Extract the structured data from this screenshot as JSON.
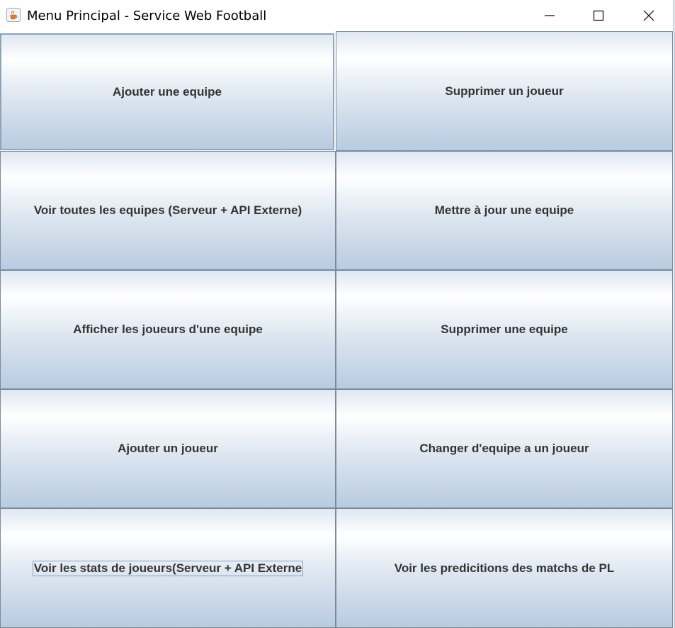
{
  "window": {
    "title": "Menu Principal - Service Web Football",
    "app_icon": "java-cup-icon",
    "controls": {
      "minimize_icon": "minimize-icon",
      "maximize_icon": "maximize-icon",
      "close_icon": "close-icon"
    }
  },
  "menu": {
    "buttons": [
      {
        "label": "Ajouter une equipe",
        "column": "left",
        "row": 1
      },
      {
        "label": "Supprimer un joueur",
        "column": "right",
        "row": 1
      },
      {
        "label": "Voir toutes les equipes (Serveur + API Externe)",
        "column": "left",
        "row": 2
      },
      {
        "label": "Mettre à jour une equipe",
        "column": "right",
        "row": 2
      },
      {
        "label": "Afficher les joueurs d'une equipe",
        "column": "left",
        "row": 3
      },
      {
        "label": "Supprimer une equipe",
        "column": "right",
        "row": 3
      },
      {
        "label": "Ajouter un joueur",
        "column": "left",
        "row": 4
      },
      {
        "label": "Changer d'equipe a un joueur",
        "column": "right",
        "row": 4
      },
      {
        "label": "Voir les stats de joueurs(Serveur + API Externe",
        "column": "left",
        "row": 5
      },
      {
        "label": "Voir les predicitions des matchs de PL",
        "column": "right",
        "row": 5
      }
    ]
  },
  "colors": {
    "button_border": "#7a8a9a",
    "button_top": "#ffffff",
    "button_bottom": "#b8cbe0",
    "button_text": "#333333"
  }
}
